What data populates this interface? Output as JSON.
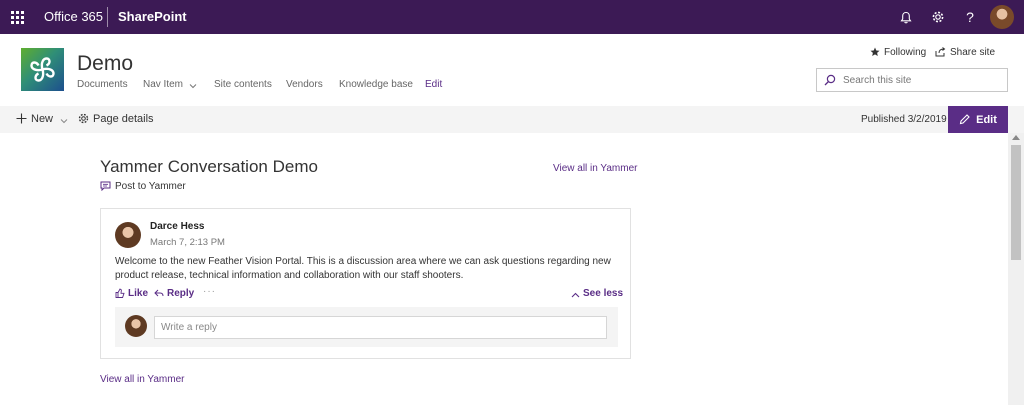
{
  "suite_bar": {
    "brand": "Office 365",
    "app": "SharePoint",
    "icons": [
      "waffle-icon",
      "bell-icon",
      "gear-icon",
      "help-icon"
    ],
    "help_glyph": "?"
  },
  "site": {
    "title": "Demo",
    "nav": [
      {
        "label": "Documents"
      },
      {
        "label": "Nav Item",
        "has_dropdown": true
      },
      {
        "label": "Site contents"
      },
      {
        "label": "Vendors"
      },
      {
        "label": "Knowledge base"
      },
      {
        "label": "Edit",
        "active": true
      }
    ],
    "following_label": "Following",
    "share_label": "Share site",
    "search_placeholder": "Search this site"
  },
  "command_bar": {
    "new_label": "New",
    "page_details_label": "Page details",
    "published_text": "Published 3/2/2019",
    "edit_label": "Edit"
  },
  "yammer": {
    "title": "Yammer Conversation Demo",
    "view_all_label": "View all in Yammer",
    "post_to_label": "Post to Yammer",
    "post": {
      "author": "Darce Hess",
      "time": "March 7, 2:13 PM",
      "body": "Welcome to the new Feather Vision Portal. This is a discussion area where we can ask questions regarding new product release, technical information and collaboration with our staff shooters.",
      "like_label": "Like",
      "reply_label": "Reply",
      "more_label": "···",
      "see_less_label": "See less"
    },
    "reply_placeholder": "Write a reply",
    "view_all_bottom_label": "View all in Yammer"
  },
  "colors": {
    "suite_bar": "#3c1a55",
    "accent": "#5a2d86",
    "command_bar_bg": "#f4f4f4"
  }
}
